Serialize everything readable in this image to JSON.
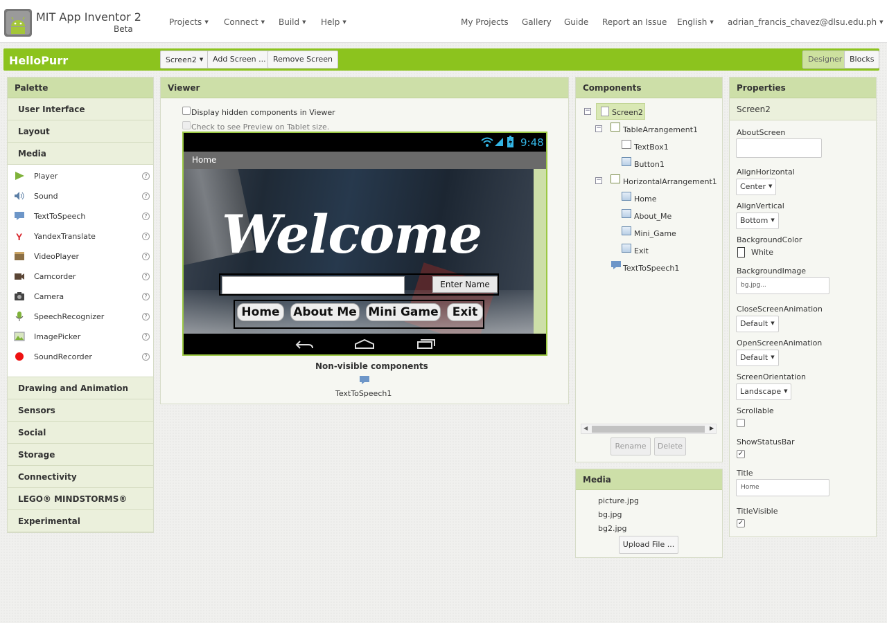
{
  "app": {
    "title": "MIT App Inventor 2",
    "subtitle": "Beta"
  },
  "topnav": {
    "left": [
      {
        "label": "Projects"
      },
      {
        "label": "Connect"
      },
      {
        "label": "Build"
      },
      {
        "label": "Help"
      }
    ],
    "right": [
      {
        "label": "My Projects"
      },
      {
        "label": "Gallery"
      },
      {
        "label": "Guide"
      },
      {
        "label": "Report an Issue"
      }
    ],
    "language": "English",
    "user": "adrian_francis_chavez@dlsu.edu.ph"
  },
  "project": {
    "name": "HelloPurr",
    "screen_select": "Screen2",
    "add_screen": "Add Screen ...",
    "remove_screen": "Remove Screen",
    "designer": "Designer",
    "blocks": "Blocks"
  },
  "palette": {
    "title": "Palette",
    "categories_top": [
      "User Interface",
      "Layout",
      "Media"
    ],
    "media_items": [
      {
        "label": "Player",
        "icon": "player-icon"
      },
      {
        "label": "Sound",
        "icon": "sound-icon"
      },
      {
        "label": "TextToSpeech",
        "icon": "text-to-speech-icon"
      },
      {
        "label": "YandexTranslate",
        "icon": "yandex-translate-icon"
      },
      {
        "label": "VideoPlayer",
        "icon": "video-player-icon"
      },
      {
        "label": "Camcorder",
        "icon": "camcorder-icon"
      },
      {
        "label": "Camera",
        "icon": "camera-icon"
      },
      {
        "label": "SpeechRecognizer",
        "icon": "speech-recognizer-icon"
      },
      {
        "label": "ImagePicker",
        "icon": "image-picker-icon"
      },
      {
        "label": "SoundRecorder",
        "icon": "sound-recorder-icon"
      }
    ],
    "help": "?",
    "categories_bottom": [
      "Drawing and Animation",
      "Sensors",
      "Social",
      "Storage",
      "Connectivity",
      "LEGO® MINDSTORMS®",
      "Experimental"
    ]
  },
  "viewer": {
    "title": "Viewer",
    "hidden_components": "Display hidden components in Viewer",
    "tablet_preview": "Check to see Preview on Tablet size.",
    "phone": {
      "time": "9:48",
      "title_bar": "Home",
      "welcome": "Welcome",
      "textbox": "",
      "enter_name": "Enter Name",
      "buttons": [
        "Home",
        "About Me",
        "Mini Game",
        "Exit"
      ]
    },
    "nonvisible_title": "Non-visible components",
    "nonvisible_item": "TextToSpeech1"
  },
  "components": {
    "title": "Components",
    "tree": {
      "screen": "Screen2",
      "table": "TableArrangement1",
      "textbox": "TextBox1",
      "button": "Button1",
      "horiz": "HorizontalArrangement1",
      "home": "Home",
      "about": "About_Me",
      "mini": "Mini_Game",
      "exit": "Exit",
      "tts": "TextToSpeech1"
    },
    "rename": "Rename",
    "delete": "Delete"
  },
  "media": {
    "title": "Media",
    "files": [
      "picture.jpg",
      "bg.jpg",
      "bg2.jpg"
    ],
    "upload": "Upload File ..."
  },
  "properties": {
    "title": "Properties",
    "component": "Screen2",
    "about_screen_label": "AboutScreen",
    "about_screen_value": "",
    "align_h_label": "AlignHorizontal",
    "align_h_value": "Center",
    "align_v_label": "AlignVertical",
    "align_v_value": "Bottom",
    "bg_color_label": "BackgroundColor",
    "bg_color_value": "White",
    "bg_image_label": "BackgroundImage",
    "bg_image_value": "bg.jpg...",
    "close_anim_label": "CloseScreenAnimation",
    "close_anim_value": "Default",
    "open_anim_label": "OpenScreenAnimation",
    "open_anim_value": "Default",
    "orientation_label": "ScreenOrientation",
    "orientation_value": "Landscape",
    "scrollable_label": "Scrollable",
    "scrollable_checked": "",
    "status_bar_label": "ShowStatusBar",
    "status_bar_checked": "✓",
    "title_label": "Title",
    "title_value": "Home",
    "title_visible_label": "TitleVisible",
    "title_visible_checked": "✓"
  },
  "colors": {
    "accent_green": "#8cc31e",
    "panel_header": "#cddfa8",
    "selection": "#d9e8b4"
  }
}
